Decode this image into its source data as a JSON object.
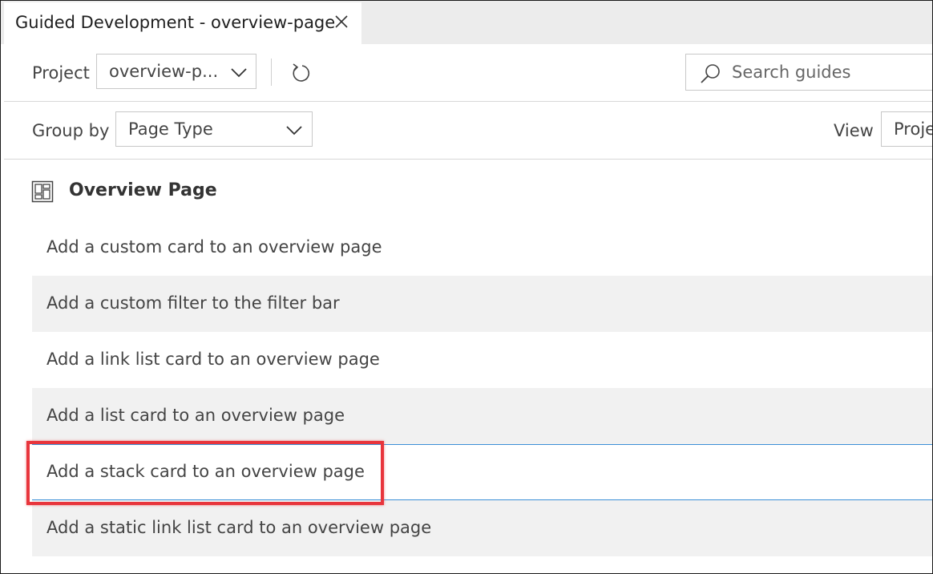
{
  "tab": {
    "title": "Guided Development - overview-page"
  },
  "toolbar": {
    "project_label": "Project",
    "project_value": "overview-p...",
    "search_placeholder": "Search guides",
    "group_by_label": "Group by",
    "group_by_value": "Page Type",
    "view_label": "View",
    "view_value": "Proje"
  },
  "group": {
    "title": "Overview Page"
  },
  "guides": [
    {
      "label": "Add a custom card to an overview page"
    },
    {
      "label": "Add a custom filter to the filter bar"
    },
    {
      "label": "Add a link list card to an overview page"
    },
    {
      "label": "Add a list card to an overview page"
    },
    {
      "label": "Add a stack card to an overview page"
    },
    {
      "label": "Add a static link list card to an overview page"
    }
  ],
  "colors": {
    "highlight": "#e8353c",
    "selected_border": "#3b8fd6",
    "alt_row": "#f1f1f1"
  },
  "icons": [
    "close-icon",
    "chevron-down-icon",
    "refresh-icon",
    "search-icon",
    "overview-page-icon"
  ]
}
